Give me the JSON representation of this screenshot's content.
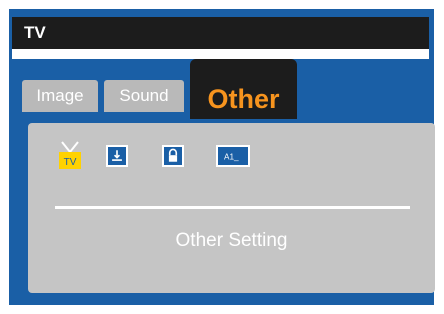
{
  "window": {
    "title": "TV"
  },
  "tabs": [
    {
      "label": "Image",
      "selected": false
    },
    {
      "label": "Sound",
      "selected": false
    },
    {
      "label": "Other",
      "selected": true
    }
  ],
  "icons": [
    {
      "name": "tv-icon",
      "glyph_text": "TV"
    },
    {
      "name": "download-icon"
    },
    {
      "name": "lock-icon"
    },
    {
      "name": "a1-icon",
      "glyph_text": "A1_"
    }
  ],
  "content": {
    "setting_label": "Other Setting"
  },
  "colors": {
    "frame_blue": "#1a5fa6",
    "title_bar": "#1c1c1c",
    "active_tab_text": "#f7941e",
    "inactive_tab": "#b9b9b9",
    "panel": "#c5c5c5",
    "tv_icon_yellow": "#ffd200"
  }
}
